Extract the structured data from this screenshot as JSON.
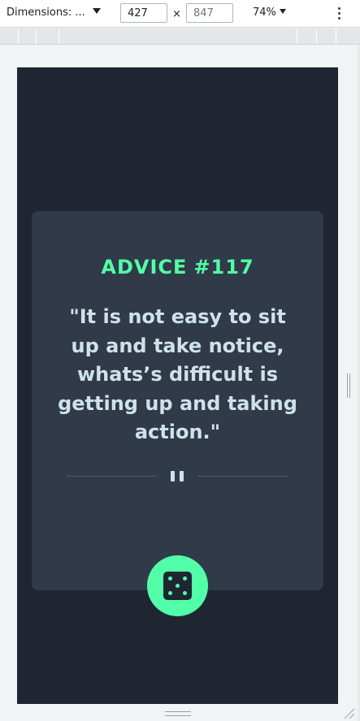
{
  "devtools": {
    "dimensions_label": "Dimensions: ...",
    "width_value": "427",
    "height_placeholder": "847",
    "times_symbol": "×",
    "zoom_label": "74%"
  },
  "advice": {
    "label": "ADVICE",
    "number": "#117",
    "quote": "\"It is not easy to sit up and take notice, whats’s difficult is getting up and taking action.\""
  },
  "colors": {
    "page_bg": "#1f2632",
    "card_bg": "#313a48",
    "accent": "#52ffa8",
    "quote_text": "#cee3e9",
    "divider": "#4f5d74"
  },
  "icons": {
    "divider_icon": "pause-icon",
    "button_icon": "dice-icon"
  }
}
